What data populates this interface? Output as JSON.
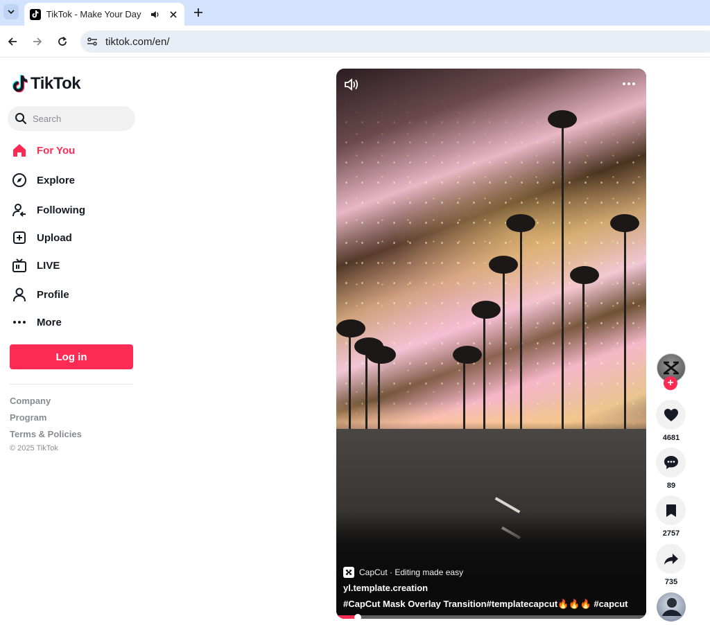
{
  "browser": {
    "tab_title": "TikTok - Make Your Day",
    "url": "tiktok.com/en/"
  },
  "sidebar": {
    "logo_text": "TikTok",
    "search_placeholder": "Search",
    "nav": [
      {
        "label": "For You",
        "icon": "home-icon",
        "active": true
      },
      {
        "label": "Explore",
        "icon": "compass-icon"
      },
      {
        "label": "Following",
        "icon": "following-icon"
      },
      {
        "label": "Upload",
        "icon": "upload-icon"
      },
      {
        "label": "LIVE",
        "icon": "live-tv-icon"
      },
      {
        "label": "Profile",
        "icon": "profile-icon"
      },
      {
        "label": "More",
        "icon": "more-icon"
      }
    ],
    "login_label": "Log in",
    "footer": {
      "company": "Company",
      "program": "Program",
      "terms": "Terms & Policies",
      "copyright": "© 2025 TikTok"
    }
  },
  "video": {
    "capcut_label": "CapCut · Editing made easy",
    "author": "yl.template.creation",
    "description": "#CapCut  Mask Overlay Transition#templatecapcut🔥🔥🔥  #capcut",
    "progress": 0.07
  },
  "actions": {
    "likes": "4681",
    "comments": "89",
    "saves": "2757",
    "shares": "735"
  },
  "colors": {
    "accent": "#fe2c55",
    "chrome_tabstrip": "#d3e3fd"
  }
}
